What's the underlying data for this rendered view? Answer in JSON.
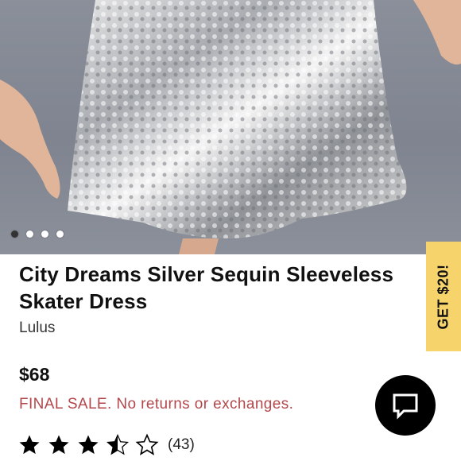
{
  "product": {
    "title": "City Dreams Silver Sequin Sleeveless Skater Dress",
    "brand": "Lulus",
    "price": "$68",
    "final_sale": "FINAL SALE. No returns or exchanges.",
    "rating": {
      "stars": 3.5,
      "max": 5,
      "count_label": "(43)"
    }
  },
  "gallery": {
    "image_count": 4,
    "active_index": 0
  },
  "promo": {
    "label": "GET $20!"
  },
  "icons": {
    "chat": "chat-bubble-icon",
    "star": "star-icon"
  },
  "colors": {
    "accent_yellow": "#f6d36b",
    "final_sale_red": "#b3474c",
    "chat_bg": "#000000"
  }
}
